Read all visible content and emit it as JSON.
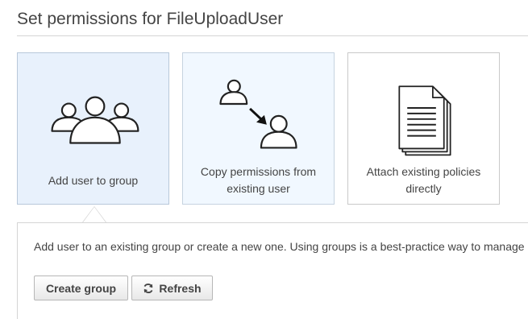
{
  "page": {
    "title": "Set permissions for FileUploadUser"
  },
  "options": [
    {
      "label": "Add user to group",
      "icon": "user-group-icon",
      "selected": true
    },
    {
      "label_line1": "Copy permissions from",
      "label_line2": "existing user",
      "icon": "copy-user-icon",
      "selected": false
    },
    {
      "label_line1": "Attach existing policies",
      "label_line2": "directly",
      "icon": "policy-documents-icon",
      "selected": false
    }
  ],
  "detail": {
    "description": "Add user to an existing group or create a new one. Using groups is a best-practice way to manage"
  },
  "buttons": {
    "create_group": "Create group",
    "refresh": "Refresh",
    "refresh_icon": "refresh-icon"
  },
  "colors": {
    "selected_card_bg": "#e8f1fc",
    "text": "#444444",
    "border": "#c9c9c9"
  }
}
